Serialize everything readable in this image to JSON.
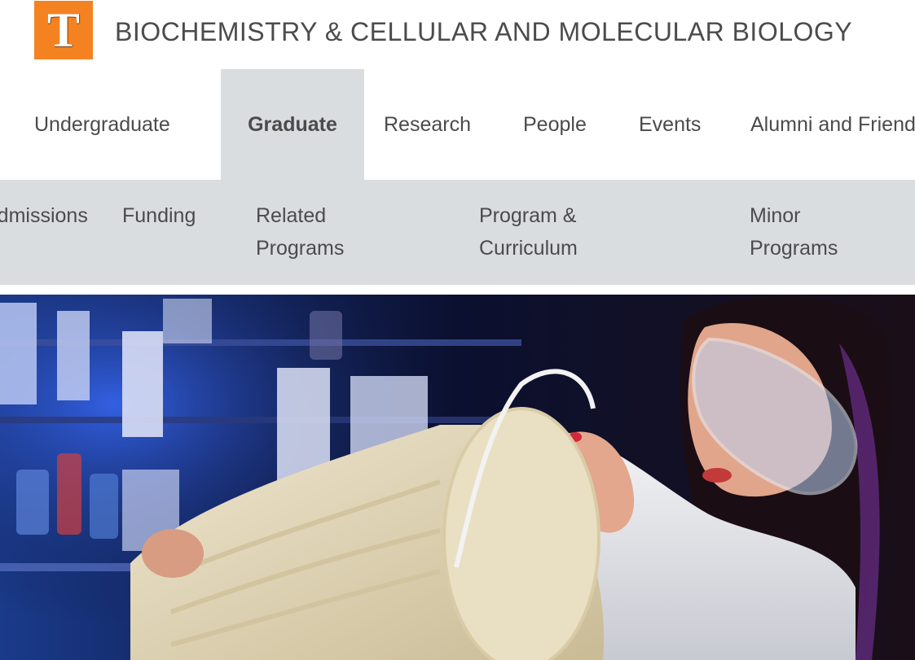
{
  "header": {
    "logo_letter": "T",
    "title": "BIOCHEMISTRY & CELLULAR AND MOLECULAR BIOLOGY"
  },
  "primary_nav": {
    "items": [
      {
        "label": "Undergraduate"
      },
      {
        "label": "Graduate",
        "active": true
      },
      {
        "label": "Research"
      },
      {
        "label": "People"
      },
      {
        "label": "Events"
      },
      {
        "label": "Alumni and Friends"
      }
    ]
  },
  "secondary_nav": {
    "items": [
      {
        "label": "Admissions"
      },
      {
        "label": "Funding"
      },
      {
        "label": "Related Programs"
      },
      {
        "label": "Program & Curriculum"
      },
      {
        "label": "Minor Programs"
      }
    ]
  },
  "hero": {
    "description_icon": "lab-photo"
  },
  "colors": {
    "brand_orange": "#f58220",
    "nav_gray": "#d9dde0",
    "text": "#4b4b4b"
  }
}
